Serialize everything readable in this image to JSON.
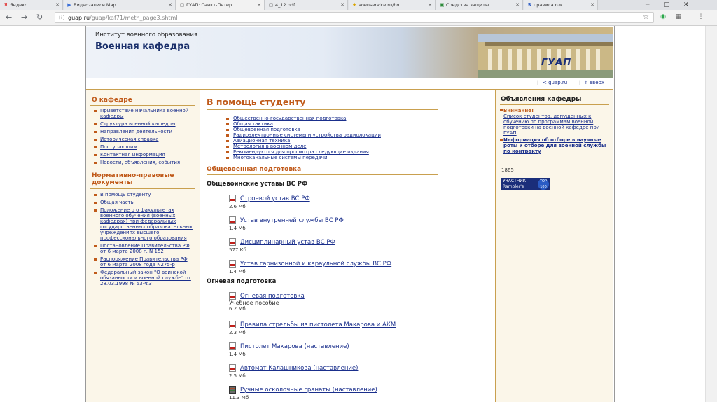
{
  "browser": {
    "tabs": [
      {
        "label": "Яндекс",
        "icon": "Я"
      },
      {
        "label": "Видеозаписи Мар",
        "icon": "▶"
      },
      {
        "label": "ГУАП: Санкт-Петер",
        "icon": "▢"
      },
      {
        "label": "4_12.pdf",
        "icon": "▢"
      },
      {
        "label": "voenservice.ru/bo",
        "icon": "♦"
      },
      {
        "label": "Средства защиты",
        "icon": "▣"
      },
      {
        "label": "правила озк",
        "icon": "S"
      }
    ],
    "url_host": "guap.ru",
    "url_path": "/guap/kaf71/meth_page3.shtml"
  },
  "banner": {
    "subtitle": "Институт военного образования",
    "title": "Военная кафедра",
    "logo": "ГУАП"
  },
  "topbar": {
    "home_link": "< guap.ru",
    "up_link": "вверх"
  },
  "left": {
    "about_heading": "О кафедре",
    "about_items": [
      "Приветствие начальника военной кафедры",
      "Структура военной кафедры",
      "Направления деятельности",
      "Историческая справка",
      "Поступающим",
      "Контактная информация",
      "Новости, объявления, события"
    ],
    "docs_heading": "Нормативно-правовые документы",
    "docs_items": [
      "В помощь студенту",
      "Общая часть",
      "Положение о о факультетах военного обучения (военных кафедрах) при федеральных государственных образовательных учреждениях высшего профессионального образования",
      "Постановление Правительства РФ от 6 марта 2008 г. N 152",
      "Распоряжение Правительства РФ от 6 марта 2008 года N275-р",
      "Федеральный закон \"О воинской обязанности и военной службе\" от 28.03.1998 № 53-ФЗ"
    ]
  },
  "main": {
    "title": "В помощь студенту",
    "toc": [
      "Общественно-государственная подготовка",
      "Общая тактика",
      "Общевоенная подготовка",
      "Радиоэлектронные системы и устройства радиолокации",
      "Авиационная техника",
      "Метрология в военном деле",
      "Рекомендуются для просмотра следующие издания",
      "Многоканальные системы передачи"
    ],
    "section_heading": "Общевоенная подготовка",
    "group1_title": "Общевоинские уставы ВС РФ",
    "group1_docs": [
      {
        "name": "Строевой устав ВС РФ",
        "size": "2.6 Мб"
      },
      {
        "name": "Устав внутренней службы ВС РФ",
        "size": "1.4 Мб"
      },
      {
        "name": "Дисциплинарный устав ВС РФ",
        "size": "577 Кб"
      },
      {
        "name": "Устав гарнизонной и караульной службы ВС РФ",
        "size": "1.4 Мб"
      }
    ],
    "group2_title": "Огневая подготовка",
    "group2_docs": [
      {
        "name": "Огневая подготовка",
        "note": "Учебное пособие",
        "size": "6.2 Мб"
      },
      {
        "name": "Правила стрельбы из пистолета Макарова и АКМ",
        "size": "2.3 Мб"
      },
      {
        "name": "Пистолет Макарова (наставление)",
        "size": "1.4 Мб"
      },
      {
        "name": "Автомат Калашникова (наставление)",
        "size": "2.5 Мб"
      },
      {
        "name": "Ручные осколочные гранаты (наставление)",
        "size": "11.3 Мб"
      }
    ]
  },
  "right": {
    "heading": "Объявления кафедры",
    "attention_label": "Внимание!",
    "attention_text": "Список студентов, допущенных к обучению по программам военной подготовки на военной кафедре при ГУАП",
    "info_text": "Информация об отборе в научные роты и отборе для военной службы по контракту",
    "counter": "1865",
    "badge_text": "УЧАСТНИК Rambler's",
    "badge_top": "TOP 100"
  }
}
